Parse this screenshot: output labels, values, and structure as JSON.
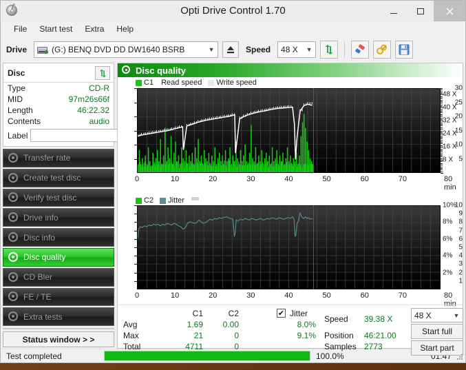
{
  "window": {
    "title": "Opti Drive Control 1.70",
    "app_icon": "disc-pen-icon",
    "minimize": "–",
    "maximize": "□",
    "close": "✕"
  },
  "menu": {
    "items": [
      "File",
      "Start test",
      "Extra",
      "Help"
    ]
  },
  "toolbar": {
    "drive_label": "Drive",
    "drive_value": "(G:)   BENQ DVD DD DW1640 BSRB",
    "eject_icon": "eject-icon",
    "speed_label": "Speed",
    "speed_value": "48 X",
    "refresh_icon": "refresh-arrows-icon",
    "eraser_icon": "eraser-icon",
    "keys_icon": "keys-icon",
    "save_icon": "floppy-save-icon"
  },
  "disc_panel": {
    "title": "Disc",
    "refresh_icon": "refresh-arrows-icon",
    "rows": [
      {
        "key": "Type",
        "value": "CD-R"
      },
      {
        "key": "MID",
        "value": "97m26s66f"
      },
      {
        "key": "Length",
        "value": "46:22.32"
      },
      {
        "key": "Contents",
        "value": "audio"
      }
    ],
    "label_key": "Label",
    "label_value": "",
    "label_placeholder": "",
    "label_button_icon": "cd-disc-icon"
  },
  "sidebar": {
    "items": [
      {
        "label": "Transfer rate",
        "icon": "disc-test-icon",
        "active": false
      },
      {
        "label": "Create test disc",
        "icon": "disc-burn-icon",
        "active": false
      },
      {
        "label": "Verify test disc",
        "icon": "disc-verify-icon",
        "active": false
      },
      {
        "label": "Drive info",
        "icon": "drive-info-icon",
        "active": false
      },
      {
        "label": "Disc info",
        "icon": "disc-info-icon",
        "active": false
      },
      {
        "label": "Disc quality",
        "icon": "disc-quality-icon",
        "active": true
      },
      {
        "label": "CD Bler",
        "icon": "disc-bler-icon",
        "active": false
      },
      {
        "label": "FE / TE",
        "icon": "disc-fete-icon",
        "active": false
      },
      {
        "label": "Extra tests",
        "icon": "disc-extra-icon",
        "active": false
      }
    ],
    "status_window_button": "Status window > >"
  },
  "main": {
    "header_title": "Disc quality",
    "header_icon": "disc-quality-icon"
  },
  "chart_data": [
    {
      "id": "c1-chart",
      "type": "line",
      "title": "C1",
      "xlabel": "min",
      "ylabel": "",
      "legend": [
        {
          "label": "C1",
          "color": "#14c814",
          "swatch": true
        },
        {
          "label": "Read speed",
          "color": "#ffffff",
          "swatch": false
        },
        {
          "label": "Write speed",
          "color": "#e8e8e8",
          "swatch": true
        }
      ],
      "legend_position": "top-left",
      "grid": true,
      "xlim": [
        0,
        80
      ],
      "xticks": [
        0,
        10,
        20,
        30,
        40,
        50,
        60,
        70,
        80
      ],
      "xtick_labels": [
        "0",
        "10",
        "20",
        "30",
        "40",
        "50",
        "60",
        "70",
        "80 min"
      ],
      "ylim": [
        0,
        30
      ],
      "yticks": [
        5,
        10,
        15,
        20,
        25,
        30
      ],
      "ytick_labels": [
        "5",
        "10",
        "15",
        "20",
        "25",
        "30"
      ],
      "y2lim": [
        0,
        52
      ],
      "y2ticks": [
        8,
        16,
        24,
        32,
        40,
        48
      ],
      "y2tick_labels": [
        "8 X",
        "16 X",
        "24 X",
        "32 X",
        "40 X",
        "48 X"
      ],
      "cursor_x": 46.35,
      "cursor_color": "#ff1010",
      "series": [
        {
          "name": "C1",
          "type": "bar",
          "color": "#14c814",
          "x": [
            0.3,
            0.7,
            1.1,
            1.5,
            1.9,
            2.3,
            2.7,
            3.1,
            3.5,
            3.9,
            4.3,
            4.7,
            5.1,
            5.5,
            5.9,
            6.3,
            6.7,
            7.1,
            7.5,
            7.9,
            8.3,
            8.7,
            9.1,
            9.5,
            9.9,
            10.3,
            10.7,
            11.1,
            11.5,
            11.9,
            12.3,
            12.7,
            13.1,
            13.5,
            13.9,
            14.3,
            14.7,
            15.1,
            15.5,
            15.9,
            16.3,
            16.7,
            17.1,
            17.5,
            17.9,
            18.3,
            18.7,
            19.1,
            19.5,
            19.9,
            20.3,
            20.7,
            21.1,
            21.5,
            21.9,
            22.3,
            22.7,
            23.1,
            23.5,
            23.9,
            24.3,
            24.7,
            25.1,
            25.5,
            25.9,
            26.3,
            26.7,
            27.1,
            27.5,
            27.9,
            28.3,
            28.7,
            29.1,
            29.5,
            29.9,
            30.3,
            30.7,
            31.1,
            31.5,
            31.9,
            32.3,
            32.7,
            33.1,
            33.5,
            33.9,
            34.3,
            34.7,
            35.1,
            35.5,
            35.9,
            36.3,
            36.7,
            37.1,
            37.5,
            37.9,
            38.3,
            38.7,
            39.1,
            39.5,
            39.9,
            40.3,
            40.7,
            41.1,
            41.5,
            41.9,
            42.3,
            42.7,
            43.1,
            43.5,
            43.9,
            44.3,
            44.7,
            45.1,
            45.5,
            45.9,
            46.2
          ],
          "values": [
            8,
            3,
            5,
            2,
            6,
            3,
            9,
            4,
            2,
            7,
            3,
            5,
            8,
            4,
            12,
            3,
            6,
            16,
            4,
            9,
            5,
            13,
            3,
            7,
            11,
            4,
            6,
            3,
            9,
            5,
            4,
            8,
            3,
            6,
            4,
            7,
            3,
            9,
            5,
            12,
            4,
            6,
            3,
            8,
            5,
            4,
            7,
            3,
            6,
            4,
            9,
            3,
            5,
            7,
            4,
            6,
            3,
            8,
            4,
            5,
            9,
            3,
            6,
            4,
            11,
            5,
            3,
            8,
            4,
            6,
            10,
            4,
            3,
            7,
            17,
            5,
            4,
            9,
            3,
            6,
            4,
            8,
            3,
            5,
            7,
            4,
            6,
            3,
            9,
            4,
            5,
            8,
            3,
            6,
            4,
            7,
            3,
            5,
            9,
            4,
            6,
            3,
            5,
            4,
            7,
            3,
            6,
            13,
            18,
            21,
            16,
            11,
            8,
            5,
            4,
            3
          ]
        },
        {
          "name": "Read speed",
          "type": "line",
          "color": "#ffffff",
          "x": [
            0,
            1,
            2,
            3,
            4,
            5,
            6,
            7,
            8,
            9,
            10,
            11,
            11.9,
            12.1,
            13,
            14,
            15,
            16,
            17,
            18,
            19,
            20,
            21,
            22,
            23,
            24,
            25,
            25.7,
            25.9,
            27,
            28,
            29,
            30,
            31,
            32,
            33,
            34,
            35,
            36,
            37,
            38,
            39,
            40,
            41,
            41.5,
            41.8,
            42.2,
            43,
            44,
            45,
            46.2
          ],
          "values": [
            22.5,
            23.2,
            23.6,
            24.0,
            24.4,
            24.8,
            25.2,
            25.6,
            26.0,
            26.6,
            27.2,
            27.8,
            28.4,
            14.0,
            28.8,
            29.6,
            30.4,
            31.2,
            31.8,
            32.4,
            32.8,
            33.2,
            33.6,
            34.0,
            34.4,
            34.8,
            35.4,
            35.8,
            12.0,
            33.4,
            34.6,
            35.6,
            36.4,
            37.0,
            37.6,
            38.0,
            38.4,
            39.0,
            39.4,
            39.8,
            40.0,
            40.2,
            40.4,
            40.6,
            30.0,
            8.0,
            22.0,
            38.0,
            41.6,
            42.4,
            41.8
          ]
        }
      ]
    },
    {
      "id": "c2-jitter-chart",
      "type": "line",
      "title": "C2 / Jitter",
      "xlabel": "min",
      "legend": [
        {
          "label": "C2",
          "color": "#14c814",
          "swatch": true
        },
        {
          "label": "Jitter",
          "color": "#5c8f96",
          "swatch": true
        }
      ],
      "legend_position": "top-left",
      "grid": true,
      "xlim": [
        0,
        80
      ],
      "xticks": [
        0,
        10,
        20,
        30,
        40,
        50,
        60,
        70,
        80
      ],
      "xtick_labels": [
        "0",
        "10",
        "20",
        "30",
        "40",
        "50",
        "60",
        "70",
        "80 min"
      ],
      "ylim": [
        0,
        10
      ],
      "yticks": [
        1,
        2,
        3,
        4,
        5,
        6,
        7,
        8,
        9,
        10
      ],
      "ytick_labels": [
        "1",
        "2",
        "3",
        "4",
        "5",
        "6",
        "7",
        "8",
        "9",
        "10"
      ],
      "y2lim": [
        0,
        10
      ],
      "y2ticks": [
        2,
        4,
        6,
        8,
        10
      ],
      "y2tick_labels": [
        "2%",
        "4%",
        "6%",
        "8%",
        "10%"
      ],
      "cursor_x": 46.35,
      "cursor_color": "#ff1010",
      "series": [
        {
          "name": "Jitter",
          "type": "line",
          "color": "#5c8f96",
          "x": [
            0,
            0.3,
            0.7,
            1.2,
            1.8,
            2.4,
            3.0,
            3.6,
            4.2,
            4.8,
            5.4,
            6.0,
            6.6,
            7.2,
            7.8,
            8.4,
            9.0,
            9.6,
            10.2,
            10.8,
            11.4,
            12.0,
            12.4,
            12.8,
            13.2,
            13.8,
            14.4,
            15.0,
            15.6,
            16.2,
            16.8,
            17.4,
            18.0,
            18.6,
            19.2,
            19.8,
            20.4,
            21.0,
            21.6,
            22.2,
            22.8,
            23.4,
            24.0,
            24.6,
            25.2,
            25.6,
            25.8,
            26.1,
            26.6,
            27.2,
            27.8,
            28.4,
            29.0,
            29.6,
            30.2,
            30.8,
            31.4,
            32.0,
            32.6,
            33.2,
            33.8,
            34.4,
            35.0,
            35.6,
            36.2,
            36.8,
            37.4,
            38.0,
            38.6,
            39.2,
            39.8,
            40.4,
            41.0,
            41.4,
            41.7,
            41.9,
            42.2,
            42.6,
            43.0,
            43.3,
            43.6,
            44.0,
            44.4,
            44.8,
            45.2,
            45.6,
            46.0,
            46.3
          ],
          "values": [
            6.1,
            7.2,
            7.5,
            7.4,
            7.6,
            7.5,
            7.7,
            7.6,
            7.8,
            7.7,
            7.8,
            7.6,
            7.8,
            7.7,
            7.9,
            7.8,
            7.7,
            7.9,
            7.8,
            7.6,
            7.5,
            7.2,
            7.3,
            7.5,
            7.9,
            8.1,
            8.0,
            7.9,
            8.0,
            8.3,
            8.1,
            7.9,
            8.0,
            8.2,
            8.4,
            8.3,
            8.5,
            8.4,
            8.6,
            8.5,
            8.6,
            8.7,
            8.6,
            8.5,
            8.4,
            6.3,
            6.7,
            8.3,
            8.2,
            8.4,
            8.3,
            8.5,
            8.4,
            8.3,
            8.5,
            8.4,
            8.3,
            8.4,
            8.5,
            8.3,
            8.4,
            8.5,
            8.4,
            8.6,
            8.5,
            8.4,
            8.6,
            8.5,
            8.4,
            8.5,
            8.6,
            8.5,
            8.7,
            8.4,
            6.3,
            6.5,
            7.9,
            8.2,
            9.2,
            8.8,
            8.6,
            8.5,
            8.7,
            8.5,
            8.6,
            8.4,
            8.5,
            8.4
          ]
        },
        {
          "name": "C2",
          "type": "bar",
          "color": "#14c814",
          "x": [],
          "values": []
        }
      ]
    }
  ],
  "stats": {
    "col_headers": [
      "C1",
      "C2"
    ],
    "row_headers": [
      "Avg",
      "Max",
      "Total"
    ],
    "c1": {
      "avg": "1.69",
      "max": "21",
      "total": "4711"
    },
    "c2": {
      "avg": "0.00",
      "max": "0",
      "total": "0"
    },
    "jitter_label": "Jitter",
    "jitter_checked": true,
    "jitter_check_glyph": "✔",
    "jitter": {
      "avg": "8.0%",
      "max": "9.1%"
    },
    "speed_label": "Speed",
    "speed_value": "39.38 X",
    "position_label": "Position",
    "position_value": "46:21.00",
    "samples_label": "Samples",
    "samples_value": "2773",
    "speed_select": "48 X",
    "start_full_button": "Start full",
    "start_part_button": "Start part"
  },
  "statusbar": {
    "text": "Test completed",
    "progress_percent": 100.0,
    "progress_label": "100.0%",
    "elapsed": "01:47"
  },
  "colors": {
    "accent_green": "#12b812",
    "c1_green": "#14c814",
    "jitter_teal": "#5c8f96",
    "read_speed_white": "#ffffff",
    "cursor_red": "#ff1010",
    "value_green": "#0a7a1f",
    "plot_bg": "#0d0d0d"
  }
}
